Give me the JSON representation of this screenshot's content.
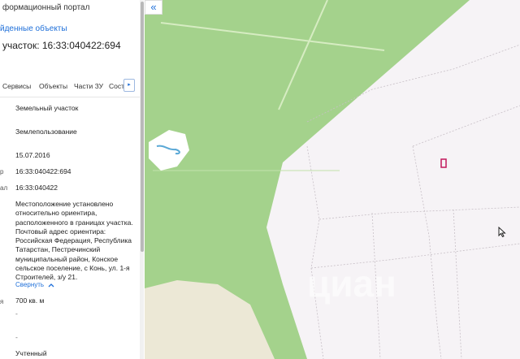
{
  "panel": {
    "portal_title": "формационный портал",
    "found_objects": "йденные объекты",
    "parcel_title": "участок: 16:33:040422:694",
    "tabs": [
      "Сервисы",
      "Объекты",
      "Части ЗУ",
      "Соста"
    ],
    "tab_scroll_icon": "▸",
    "rows": {
      "type": "Земельный участок",
      "land_use": "Землепользование",
      "date": "15.07.2016",
      "cadastral_label": "р",
      "cadastral_number": "16:33:040422:694",
      "quarter_label": "ал",
      "quarter_number": "16:33:040422",
      "address": "Местоположение установлено относительно ориентира, расположенного в границах участка. Почтовый адрес ориентира: Российская Федерация, Республика Татарстан, Пестречинский муниципальный район, Конское сельское поселение, с Конь, ул. 1-я Строителей, з/у 21.",
      "collapse": "Свернуть",
      "collapse_icon": "chevron-up-icon",
      "area_label": "я",
      "area": "700 кв. м",
      "dash1": "-",
      "dash2": "-",
      "status": "Учтенный"
    }
  },
  "map": {
    "collapse_icon": "«",
    "watermark": "циан",
    "colors": {
      "forest": "#a4d28c",
      "background": "#f6f3f6",
      "road": "#d8ebc5",
      "water": "#5aa8d6",
      "field": "#ece8d6",
      "boundary": "#c7bfc6",
      "parcel_highlight": "#c2185b"
    }
  }
}
